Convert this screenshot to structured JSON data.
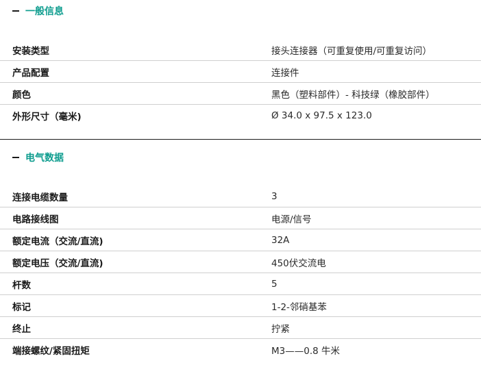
{
  "sections": [
    {
      "title": "一般信息",
      "rows": [
        {
          "label": "安装类型",
          "value": "接头连接器（可重复使用/可重复访问）"
        },
        {
          "label": "产品配置",
          "value": "连接件"
        },
        {
          "label": "颜色",
          "value": "黑色（塑料部件）- 科技绿（橡胶部件）"
        },
        {
          "label": "外形尺寸（毫米)",
          "value": "Ø 34.0 x 97.5 x 123.0"
        }
      ]
    },
    {
      "title": "电气数据",
      "rows": [
        {
          "label": "连接电缆数量",
          "value": "3"
        },
        {
          "label": "电路接线图",
          "value": "电源/信号"
        },
        {
          "label": "额定电流（交流/直流)",
          "value": "32A"
        },
        {
          "label": "额定电压（交流/直流)",
          "value": "450伏交流电"
        },
        {
          "label": "杆数",
          "value": "5"
        },
        {
          "label": "标记",
          "value": "1-2-邻硝基苯"
        },
        {
          "label": "终止",
          "value": "拧紧"
        },
        {
          "label": "端接螺纹/紧固扭矩",
          "value": "M3——0.8 牛米"
        }
      ]
    }
  ]
}
